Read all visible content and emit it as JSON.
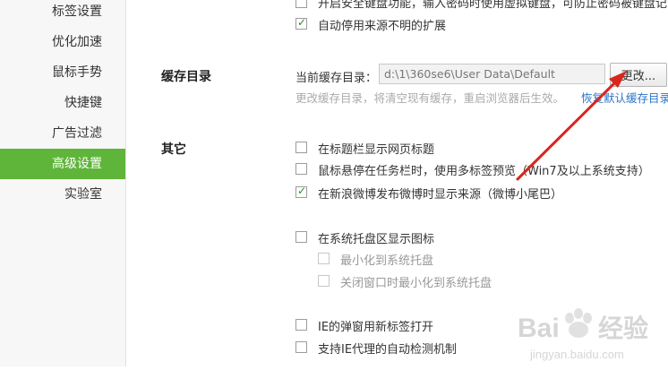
{
  "sidebar": {
    "items": [
      {
        "label": "标签设置"
      },
      {
        "label": "优化加速"
      },
      {
        "label": "鼠标手势"
      },
      {
        "label": "快捷键"
      },
      {
        "label": "广告过滤"
      },
      {
        "label": "高级设置",
        "active": true
      },
      {
        "label": "实验室"
      }
    ]
  },
  "top_options": [
    {
      "label": "开启安全键盘功能，输入密码时使用虚拟键盘，可防止密码被键盘记",
      "checked": false
    },
    {
      "label": "自动停用来源不明的扩展",
      "checked": true
    }
  ],
  "cache": {
    "section_label": "缓存目录",
    "current_label": "当前缓存目录：",
    "path_value": "d:\\1\\360se6\\User Data\\Default",
    "change_button": "更改...",
    "hint": "更改缓存目录，将清空现有缓存，重启浏览器后生效。",
    "restore_link": "恢复默认缓存目录"
  },
  "other": {
    "section_label": "其它",
    "options": [
      {
        "label": "在标题栏显示网页标题",
        "checked": false
      },
      {
        "label": "鼠标悬停在任务栏时，使用多标签预览（Win7及以上系统支持）",
        "checked": false
      },
      {
        "label": "在新浪微博发布微博时显示来源（微博小尾巴）",
        "checked": true
      },
      {
        "label": "在系统托盘区显示图标",
        "checked": false
      },
      {
        "label": "最小化到系统托盘",
        "checked": false,
        "disabled": true
      },
      {
        "label": "关闭窗口时最小化到系统托盘",
        "checked": false,
        "disabled": true
      },
      {
        "label": "IE的弹窗用新标签打开",
        "checked": false
      },
      {
        "label": "支持IE代理的自动检测机制",
        "checked": false
      }
    ]
  },
  "watermark": {
    "brand": "Bai",
    "brand2": "经验",
    "url": "jingyan.baidu.com"
  },
  "colors": {
    "accent": "#5fb53a",
    "arrow": "#d9261c",
    "link": "#2a73c8"
  }
}
